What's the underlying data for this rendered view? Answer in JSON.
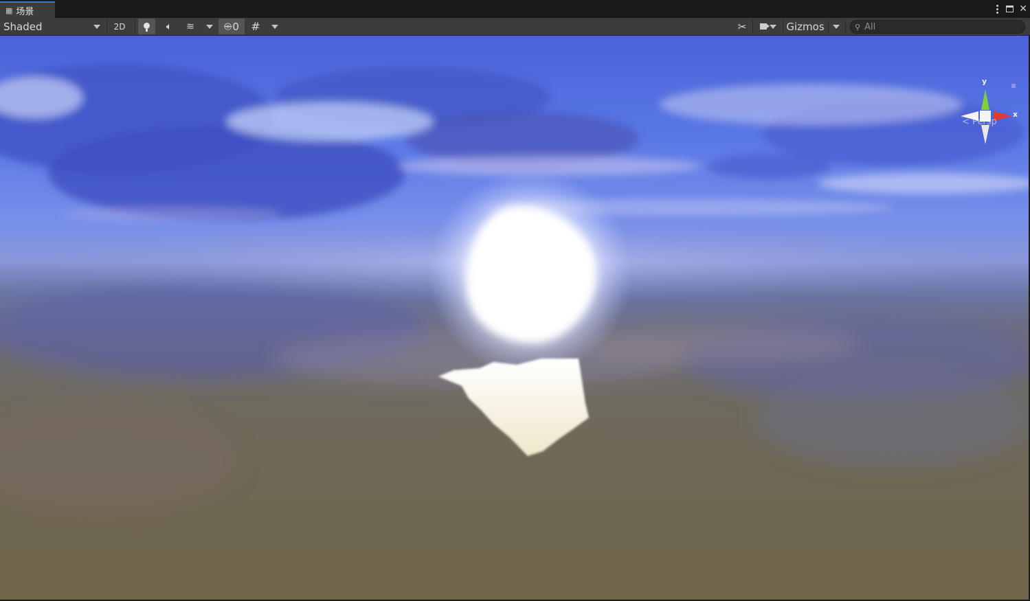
{
  "window": {
    "tab_label": "场景",
    "tab_icon": "scene-grid-icon",
    "controls": [
      "kebab-menu-icon",
      "maximize-icon",
      "close-icon"
    ]
  },
  "toolbar": {
    "draw_mode": "Shaded",
    "btn_2d": "2D",
    "scene_visibility_count": "0",
    "gizmos_label": "Gizmos",
    "search_placeholder": "All"
  },
  "gizmo": {
    "y_label": "y",
    "x_label": "x",
    "projection_label": "< Persp",
    "colors": {
      "y_axis": "#7fd13a",
      "x_axis": "#e23b2e",
      "neutral": "#ffffff"
    }
  },
  "scene": {
    "sky_color": "#5a78e6",
    "ground_color": "#6e6549",
    "sun_color": "#ffffff"
  }
}
